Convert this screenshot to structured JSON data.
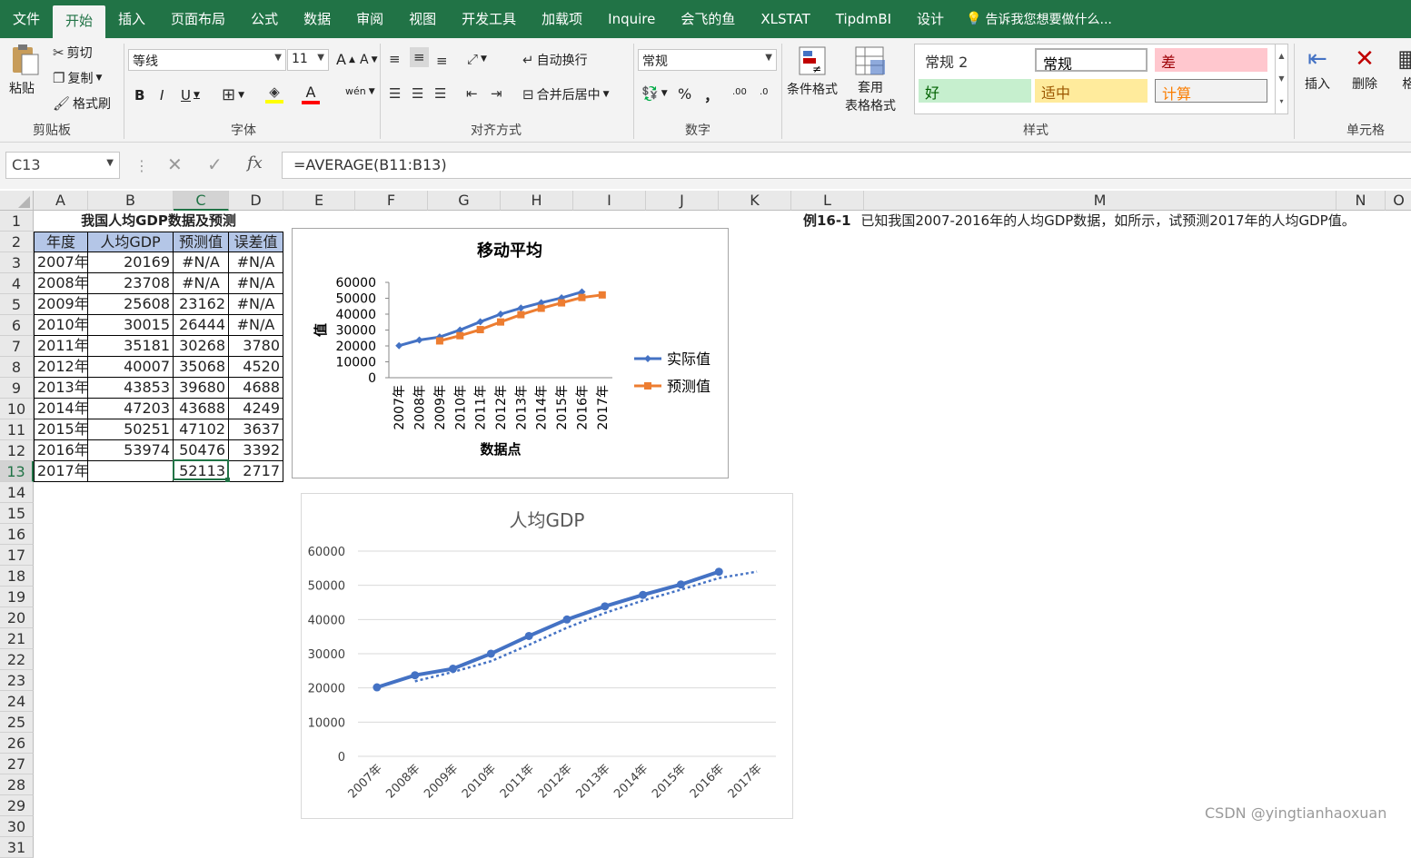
{
  "tabs": [
    "文件",
    "开始",
    "插入",
    "页面布局",
    "公式",
    "数据",
    "审阅",
    "视图",
    "开发工具",
    "加载项",
    "Inquire",
    "会飞的鱼",
    "XLSTAT",
    "TipdmBI",
    "设计"
  ],
  "active_tab": "开始",
  "tell_me": "告诉我您想要做什么...",
  "clipboard": {
    "paste": "粘贴",
    "cut": "剪切",
    "copy": "复制",
    "format_painter": "格式刷",
    "label": "剪贴板"
  },
  "font": {
    "name": "等线",
    "size": "11",
    "label": "字体",
    "bold": "B",
    "italic": "I",
    "underline": "U",
    "grow": "A",
    "shrink": "A",
    "phonetic": "wén",
    "font_color": "A"
  },
  "alignment": {
    "wrap": "自动换行",
    "merge": "合并后居中",
    "label": "对齐方式"
  },
  "number": {
    "format": "常规",
    "label": "数字",
    "percent": "%",
    "comma": "，",
    "increase_decimal": ".00",
    "decrease_decimal": ".0"
  },
  "styles": {
    "conditional": "条件格式",
    "table_fmt_1": "套用",
    "table_fmt_2": "表格格式",
    "label": "样式",
    "items": [
      {
        "text": "常规 2",
        "bg": "#ffffff",
        "fg": "#333333"
      },
      {
        "text": "常规",
        "bg": "#ffffff",
        "fg": "#000000"
      },
      {
        "text": "差",
        "bg": "#ffc7ce",
        "fg": "#9c0006"
      },
      {
        "text": "好",
        "bg": "#c6efce",
        "fg": "#006100"
      },
      {
        "text": "适中",
        "bg": "#ffeb9c",
        "fg": "#9c5700"
      },
      {
        "text": "计算",
        "bg": "#f2f2f2",
        "fg": "#fa7d00"
      }
    ]
  },
  "cells_group": {
    "insert": "插入",
    "delete": "删除",
    "format": "格",
    "label": "单元格"
  },
  "formula_bar": {
    "name_box": "C13",
    "formula": "=AVERAGE(B11:B13)",
    "fx": "fx"
  },
  "columns": [
    "A",
    "B",
    "C",
    "D",
    "E",
    "F",
    "G",
    "H",
    "I",
    "J",
    "K",
    "L",
    "M",
    "N",
    "O"
  ],
  "rows": [
    "1",
    "2",
    "3",
    "4",
    "5",
    "6",
    "7",
    "8",
    "9",
    "10",
    "11",
    "12",
    "13",
    "14",
    "15",
    "16",
    "17",
    "18",
    "19",
    "20",
    "21",
    "22",
    "23",
    "24",
    "25",
    "26",
    "27",
    "28",
    "29",
    "30",
    "31"
  ],
  "table": {
    "title": "我国人均GDP数据及预测",
    "headers": [
      "年度",
      "人均GDP",
      "预测值",
      "误差值"
    ],
    "rows": [
      [
        "2007年",
        "20169",
        "#N/A",
        "#N/A"
      ],
      [
        "2008年",
        "23708",
        "#N/A",
        "#N/A"
      ],
      [
        "2009年",
        "25608",
        "23162",
        "#N/A"
      ],
      [
        "2010年",
        "30015",
        "26444",
        "#N/A"
      ],
      [
        "2011年",
        "35181",
        "30268",
        "3780"
      ],
      [
        "2012年",
        "40007",
        "35068",
        "4520"
      ],
      [
        "2013年",
        "43853",
        "39680",
        "4688"
      ],
      [
        "2014年",
        "47203",
        "43688",
        "4249"
      ],
      [
        "2015年",
        "50251",
        "47102",
        "3637"
      ],
      [
        "2016年",
        "53974",
        "50476",
        "3392"
      ],
      [
        "2017年",
        "",
        "52113",
        "2717"
      ]
    ]
  },
  "note": {
    "bold": "例16-1",
    "text": "已知我国2007-2016年的人均GDP数据，如所示，试预测2017年的人均GDP值。"
  },
  "watermark": "CSDN @yingtianhaoxuan",
  "chart_data": [
    {
      "type": "line",
      "title": "移动平均",
      "xlabel": "数据点",
      "ylabel": "值",
      "categories": [
        "2007年",
        "2008年",
        "2009年",
        "2010年",
        "2011年",
        "2012年",
        "2013年",
        "2014年",
        "2015年",
        "2016年",
        "2017年"
      ],
      "yticks": [
        "0",
        "10000",
        "20000",
        "30000",
        "40000",
        "50000",
        "60000"
      ],
      "ylim": [
        0,
        60000
      ],
      "legend": "right",
      "series": [
        {
          "name": "实际值",
          "color": "#4472c4",
          "values": [
            20169,
            23708,
            25608,
            30015,
            35181,
            40007,
            43853,
            47203,
            50251,
            53974,
            null
          ]
        },
        {
          "name": "预测值",
          "color": "#ed7d31",
          "values": [
            null,
            null,
            23162,
            26444,
            30268,
            35068,
            39680,
            43688,
            47102,
            50476,
            52113
          ]
        }
      ]
    },
    {
      "type": "line",
      "title": "人均GDP",
      "categories": [
        "2007年",
        "2008年",
        "2009年",
        "2010年",
        "2011年",
        "2012年",
        "2013年",
        "2014年",
        "2015年",
        "2016年",
        "2017年"
      ],
      "yticks": [
        "0",
        "10000",
        "20000",
        "30000",
        "40000",
        "50000",
        "60000"
      ],
      "ylim": [
        0,
        60000
      ],
      "grid": true,
      "series": [
        {
          "color": "#4472c4",
          "values": [
            20169,
            23708,
            25608,
            30015,
            35181,
            40007,
            43853,
            47203,
            50251,
            53974,
            null
          ]
        },
        {
          "color": "#4472c4",
          "dashed": true,
          "values": [
            null,
            21939,
            24658,
            27812,
            32598,
            37594,
            41930,
            45528,
            48727,
            52113,
            54000
          ]
        }
      ]
    }
  ]
}
